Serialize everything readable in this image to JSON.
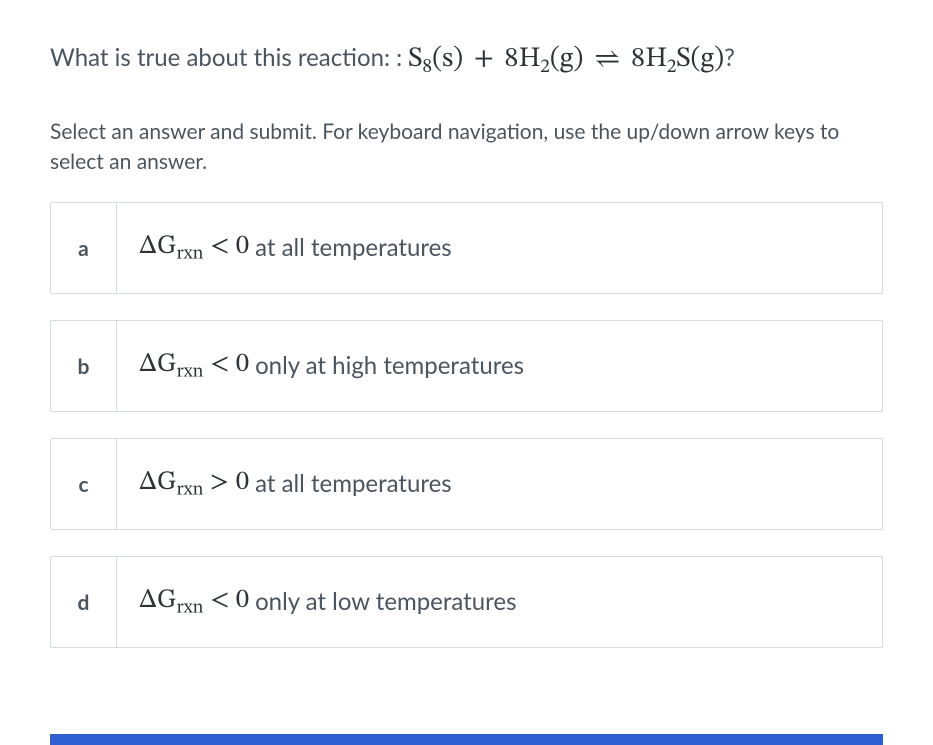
{
  "question": {
    "prefix": "What is true about this reaction: : ",
    "reaction_left_species": "S",
    "reaction_left_sub": "8",
    "reaction_left_state": "(s)",
    "plus": " + ",
    "reaction_mid_coef": "8H",
    "reaction_mid_sub": "2",
    "reaction_mid_state": "(g)",
    "arrow": " ⇌ ",
    "reaction_right_coef": "8H",
    "reaction_right_sub": "2",
    "reaction_right_tail": "S(g)",
    "suffix": "?"
  },
  "instructions": "Select an answer and submit. For keyboard navigation, use the up/down arrow keys to select an answer.",
  "expr": {
    "delta": "ΔG",
    "sub": "rxn",
    "lt0": " < 0",
    "gt0": " > 0"
  },
  "options": [
    {
      "letter": "a",
      "op": "lt",
      "tail": "at all temperatures"
    },
    {
      "letter": "b",
      "op": "lt",
      "tail": "only at high temperatures"
    },
    {
      "letter": "c",
      "op": "gt",
      "tail": "at all temperatures"
    },
    {
      "letter": "d",
      "op": "lt",
      "tail": "only at low temperatures"
    }
  ]
}
